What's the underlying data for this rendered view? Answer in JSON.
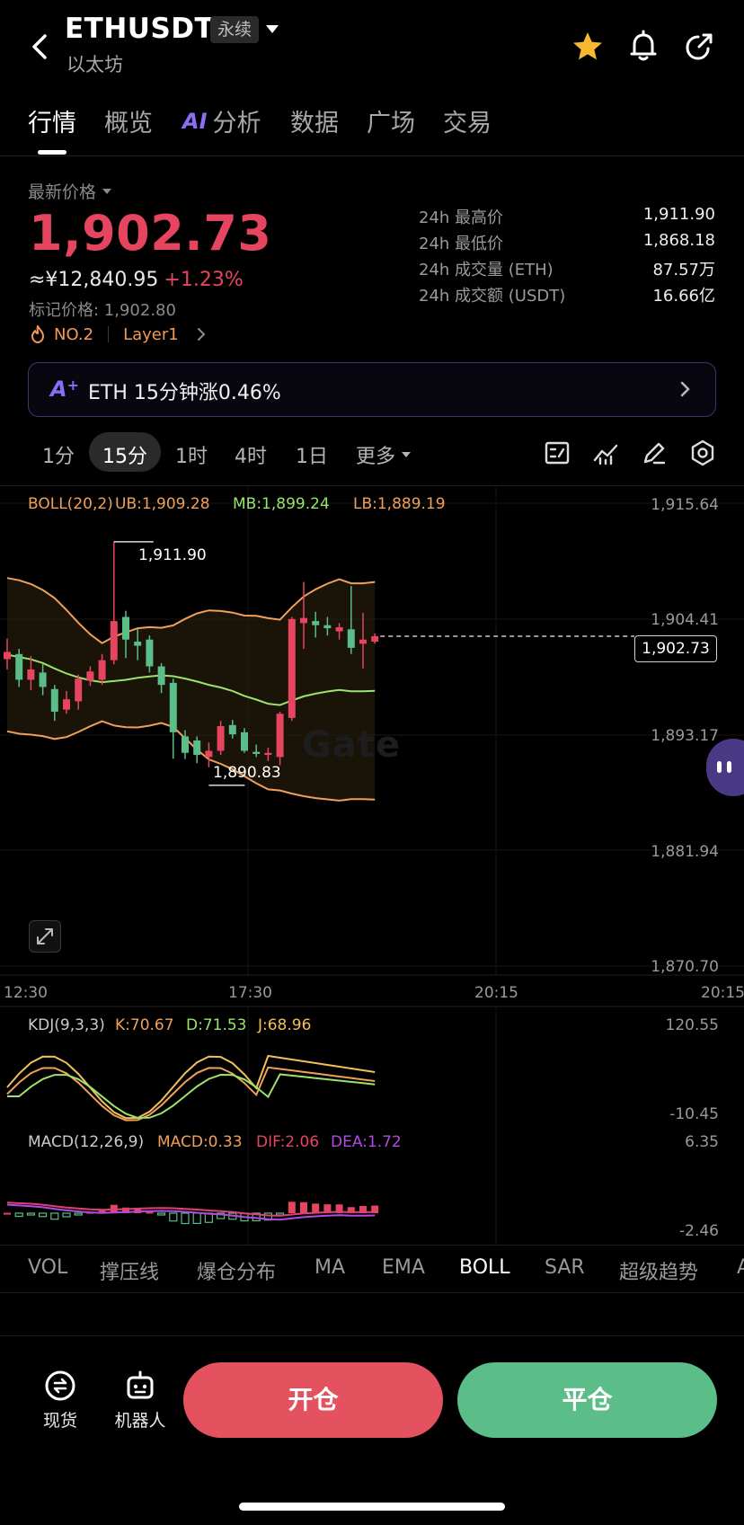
{
  "header": {
    "symbol": "ETHUSDT",
    "contract_type": "永续",
    "name": "以太坊"
  },
  "tabs": [
    {
      "label": "行情",
      "active": true
    },
    {
      "label": "概览"
    },
    {
      "label": "分析",
      "ai_prefix": "AI"
    },
    {
      "label": "数据"
    },
    {
      "label": "广场"
    },
    {
      "label": "交易"
    }
  ],
  "price": {
    "label": "最新价格",
    "last": "1,902.73",
    "cny": "≈¥12,840.95",
    "change_pct": "+1.23%",
    "mark_price": "标记价格: 1,902.80",
    "rank": "NO.2",
    "category": "Layer1"
  },
  "stats": [
    {
      "label": "24h 最高价",
      "value": "1,911.90"
    },
    {
      "label": "24h 最低价",
      "value": "1,868.18"
    },
    {
      "label": "24h 成交量 (ETH)",
      "value": "87.57万"
    },
    {
      "label": "24h 成交额 (USDT)",
      "value": "16.66亿"
    }
  ],
  "ai_bar": {
    "text": "ETH 15分钟涨0.46%"
  },
  "intervals": [
    {
      "label": "1分"
    },
    {
      "label": "15分",
      "active": true
    },
    {
      "label": "1时"
    },
    {
      "label": "4时"
    },
    {
      "label": "1日"
    },
    {
      "label": "更多"
    }
  ],
  "chart": {
    "boll_name": "BOLL(20,2)",
    "ub": "UB:1,909.28",
    "mb": "MB:1,899.24",
    "lb": "LB:1,889.19",
    "y_ticks": [
      "1,915.64",
      "1,904.41",
      "1,893.17",
      "1,881.94",
      "1,870.70"
    ],
    "x_ticks": [
      "12:30",
      "17:30",
      "20:15",
      "20:15"
    ],
    "high_annot": "1,911.90",
    "low_annot": "1,890.83",
    "current_tag": "1,902.73",
    "watermark": "Gate",
    "kdj_name": "KDJ(9,3,3)",
    "kdj_k": "K:70.67",
    "kdj_d": "D:71.53",
    "kdj_j": "J:68.96",
    "kdj_top": "120.55",
    "kdj_bottom": "-10.45",
    "macd_name": "MACD(12,26,9)",
    "macd_val": "MACD:0.33",
    "macd_dif": "DIF:2.06",
    "macd_dea": "DEA:1.72",
    "macd_top": "6.35",
    "macd_bottom": "-2.46",
    "colors": {
      "up": "#e5455f",
      "down": "#5bbd88",
      "ub": "#f0a05a",
      "mb": "#9be36a",
      "lb": "#f0a05a"
    }
  },
  "chart_data": {
    "type": "candlestick",
    "y_range": [
      1870.7,
      1915.64
    ],
    "candles": [
      {
        "o": 1900.5,
        "c": 1901.2,
        "h": 1902.5,
        "l": 1899.5
      },
      {
        "o": 1901.0,
        "c": 1898.5,
        "h": 1901.5,
        "l": 1897.8
      },
      {
        "o": 1898.5,
        "c": 1899.5,
        "h": 1900.8,
        "l": 1897.5
      },
      {
        "o": 1899.2,
        "c": 1897.8,
        "h": 1900.0,
        "l": 1897.0
      },
      {
        "o": 1897.6,
        "c": 1895.4,
        "h": 1898.0,
        "l": 1894.5
      },
      {
        "o": 1895.6,
        "c": 1896.6,
        "h": 1897.4,
        "l": 1895.2
      },
      {
        "o": 1896.4,
        "c": 1898.6,
        "h": 1899.0,
        "l": 1895.6
      },
      {
        "o": 1898.4,
        "c": 1899.3,
        "h": 1899.8,
        "l": 1897.9
      },
      {
        "o": 1898.5,
        "c": 1900.4,
        "h": 1901.0,
        "l": 1898.0
      },
      {
        "o": 1900.4,
        "c": 1904.2,
        "h": 1911.9,
        "l": 1900.0
      },
      {
        "o": 1904.6,
        "c": 1902.4,
        "h": 1905.2,
        "l": 1900.6
      },
      {
        "o": 1902.2,
        "c": 1901.8,
        "h": 1903.4,
        "l": 1900.4
      },
      {
        "o": 1902.4,
        "c": 1899.8,
        "h": 1902.8,
        "l": 1899.2
      },
      {
        "o": 1899.8,
        "c": 1898.0,
        "h": 1900.1,
        "l": 1897.2
      },
      {
        "o": 1898.2,
        "c": 1893.4,
        "h": 1898.6,
        "l": 1890.83
      },
      {
        "o": 1893.0,
        "c": 1891.4,
        "h": 1893.6,
        "l": 1890.8
      },
      {
        "o": 1892.6,
        "c": 1891.2,
        "h": 1893.0,
        "l": 1890.4
      },
      {
        "o": 1891.0,
        "c": 1891.6,
        "h": 1892.4,
        "l": 1890.0
      },
      {
        "o": 1891.6,
        "c": 1894.0,
        "h": 1894.5,
        "l": 1891.2
      },
      {
        "o": 1894.1,
        "c": 1893.2,
        "h": 1894.6,
        "l": 1892.8
      },
      {
        "o": 1893.4,
        "c": 1891.6,
        "h": 1893.8,
        "l": 1891.4
      },
      {
        "o": 1891.5,
        "c": 1891.3,
        "h": 1892.2,
        "l": 1891.0
      },
      {
        "o": 1891.2,
        "c": 1891.4,
        "h": 1891.9,
        "l": 1890.6
      },
      {
        "o": 1891.0,
        "c": 1895.2,
        "h": 1895.4,
        "l": 1890.2
      },
      {
        "o": 1894.8,
        "c": 1904.4,
        "h": 1904.6,
        "l": 1894.5
      },
      {
        "o": 1904.0,
        "c": 1904.5,
        "h": 1908.0,
        "l": 1901.5
      },
      {
        "o": 1904.2,
        "c": 1903.8,
        "h": 1905.1,
        "l": 1902.6
      },
      {
        "o": 1903.8,
        "c": 1903.5,
        "h": 1904.6,
        "l": 1902.8
      },
      {
        "o": 1903.2,
        "c": 1903.6,
        "h": 1904.0,
        "l": 1902.4
      },
      {
        "o": 1903.4,
        "c": 1901.6,
        "h": 1907.6,
        "l": 1901.0
      },
      {
        "o": 1902.0,
        "c": 1902.4,
        "h": 1905.0,
        "l": 1899.6
      },
      {
        "o": 1902.2,
        "c": 1902.73,
        "h": 1903.0,
        "l": 1902.0
      }
    ]
  },
  "indicator_tabs": [
    "VOL",
    "撑压线",
    "爆仓分布",
    "MA",
    "EMA",
    "BOLL",
    "SAR",
    "超级趋势",
    "A"
  ],
  "bottom": {
    "spot_label": "现货",
    "bot_label": "机器人",
    "open_label": "开仓",
    "close_label": "平仓"
  }
}
